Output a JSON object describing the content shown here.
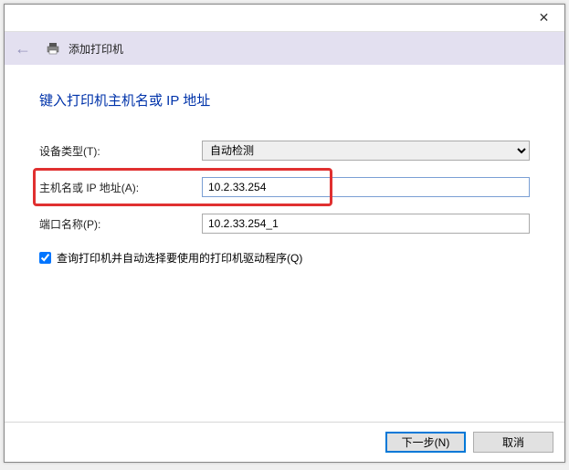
{
  "titlebar": {
    "close_tooltip": "关闭"
  },
  "header": {
    "title": "添加打印机"
  },
  "content": {
    "heading": "键入打印机主机名或 IP 地址",
    "device_type_label": "设备类型(T):",
    "device_type_value": "自动检测",
    "hostname_label": "主机名或 IP 地址(A):",
    "hostname_value": "10.2.33.254",
    "port_label": "端口名称(P):",
    "port_value": "10.2.33.254_1",
    "checkbox_label": "查询打印机并自动选择要使用的打印机驱动程序(Q)"
  },
  "footer": {
    "next_label": "下一步(N)",
    "cancel_label": "取消"
  }
}
